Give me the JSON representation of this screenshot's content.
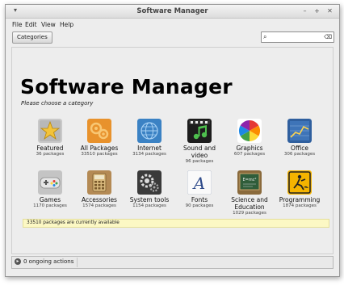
{
  "window": {
    "title": "Software Manager"
  },
  "menu": [
    "File",
    "Edit",
    "View",
    "Help"
  ],
  "toolbar": {
    "categories_label": "Categories"
  },
  "search": {
    "value": "",
    "placeholder": ""
  },
  "main": {
    "title": "Software Manager",
    "subtitle": "Please choose a category",
    "categories": [
      {
        "name": "Featured",
        "count": "36 packages",
        "icon": "star-icon"
      },
      {
        "name": "All Packages",
        "count": "33510 packages",
        "icon": "all-packages-icon"
      },
      {
        "name": "Internet",
        "count": "3134 packages",
        "icon": "internet-icon"
      },
      {
        "name": "Sound and video",
        "count": "96 packages",
        "icon": "sound-video-icon"
      },
      {
        "name": "Graphics",
        "count": "607 packages",
        "icon": "graphics-icon"
      },
      {
        "name": "Office",
        "count": "306 packages",
        "icon": "office-icon"
      },
      {
        "name": "Games",
        "count": "1170 packages",
        "icon": "games-icon"
      },
      {
        "name": "Accessories",
        "count": "1574 packages",
        "icon": "accessories-icon"
      },
      {
        "name": "System tools",
        "count": "1154 packages",
        "icon": "system-tools-icon"
      },
      {
        "name": "Fonts",
        "count": "90 packages",
        "icon": "fonts-icon"
      },
      {
        "name": "Science and Education",
        "count": "1029 packages",
        "icon": "science-education-icon"
      },
      {
        "name": "Programming",
        "count": "1874 packages",
        "icon": "programming-icon"
      }
    ],
    "info": "33510 packages are currently available"
  },
  "status": {
    "text": "0 ongoing actions"
  },
  "colors": {
    "info_bar": "#fcf8c4",
    "window_bg": "#ededed"
  }
}
